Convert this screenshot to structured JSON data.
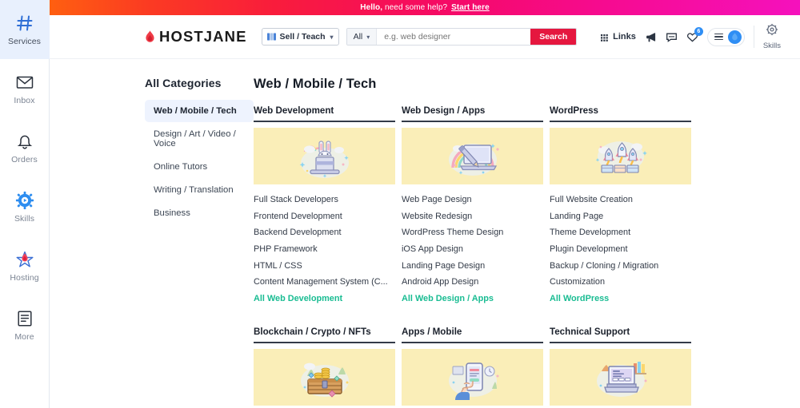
{
  "banner": {
    "greeting_bold": "Hello,",
    "greeting_rest": " need some help? ",
    "link": "Start here"
  },
  "rail": {
    "items": [
      {
        "label": "Services",
        "icon": "hash-icon",
        "active": true
      },
      {
        "label": "Inbox",
        "icon": "envelope-icon",
        "active": false
      },
      {
        "label": "Orders",
        "icon": "bell-icon",
        "active": false
      },
      {
        "label": "Skills",
        "icon": "gear-play-icon",
        "active": false
      },
      {
        "label": "Hosting",
        "icon": "flame-star-icon",
        "active": false
      },
      {
        "label": "More",
        "icon": "document-icon",
        "active": false
      }
    ]
  },
  "header": {
    "logo": "HOSTJANE",
    "sell_button": "Sell / Teach",
    "search_scope": "All",
    "search_value": "",
    "search_placeholder": "e.g. web designer",
    "search_button": "Search",
    "links_label": "Links",
    "favorites_badge": "6",
    "skills_label": "Skills",
    "accent_red": "#e5173f",
    "accent_blue": "#2f8ef4"
  },
  "sidebar": {
    "title": "All Categories",
    "items": [
      {
        "label": "Web / Mobile / Tech",
        "active": true
      },
      {
        "label": "Design / Art / Video / Voice",
        "active": false
      },
      {
        "label": "Online Tutors",
        "active": false
      },
      {
        "label": "Writing / Translation",
        "active": false
      },
      {
        "label": "Business",
        "active": false
      }
    ]
  },
  "main": {
    "title": "Web / Mobile / Tech",
    "tile_bg": "#faeeb8",
    "all_link_color": "#19bc92",
    "cards": [
      {
        "title": "Web Development",
        "image": "magic-hat-rabbit-illustration",
        "links": [
          "Full Stack Developers",
          "Frontend Development",
          "Backend Development",
          "PHP Framework",
          "HTML / CSS",
          "Content Management System (C..."
        ],
        "all_link": "All Web Development"
      },
      {
        "title": "Web Design / Apps",
        "image": "laptop-pencil-rainbow-illustration",
        "links": [
          "Web Page Design",
          "Website Redesign",
          "WordPress Theme Design",
          "iOS App Design",
          "Landing Page Design",
          "Android App Design"
        ],
        "all_link": "All Web Design / Apps"
      },
      {
        "title": "WordPress",
        "image": "rockets-launch-illustration",
        "links": [
          "Full Website Creation",
          "Landing Page",
          "Theme Development",
          "Plugin Development",
          "Backup / Cloning / Migration",
          "Customization"
        ],
        "all_link": "All WordPress"
      },
      {
        "title": "Blockchain / Crypto / NFTs",
        "image": "treasure-chest-coins-illustration",
        "links": [],
        "all_link": ""
      },
      {
        "title": "Apps / Mobile",
        "image": "hand-smartphone-illustration",
        "links": [],
        "all_link": ""
      },
      {
        "title": "Technical Support",
        "image": "laptop-desk-illustration",
        "links": [],
        "all_link": ""
      }
    ]
  }
}
